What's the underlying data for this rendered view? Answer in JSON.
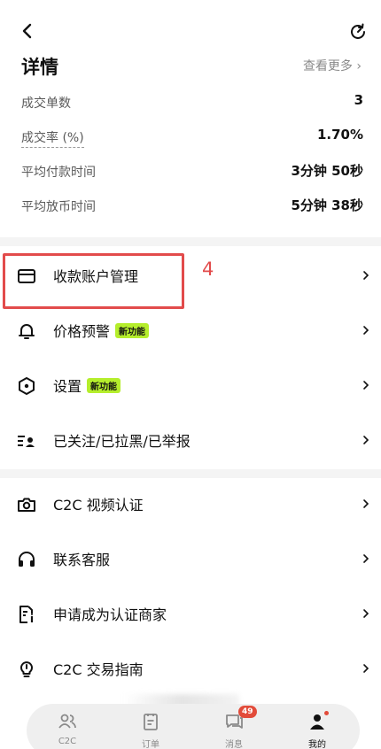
{
  "header": {
    "back_icon": "back-arrow-icon",
    "refresh_icon": "refresh-icon"
  },
  "details": {
    "title": "详情",
    "view_more": "查看更多 ›",
    "stats": [
      {
        "label": "成交单数",
        "value": "3"
      },
      {
        "label": "成交率 (%)",
        "value": "1.70%"
      },
      {
        "label": "平均付款时间",
        "value": "3分钟 50秒"
      },
      {
        "label": "平均放币时间",
        "value": "5分钟 38秒"
      }
    ]
  },
  "menu": {
    "group1": [
      {
        "label": "收款账户管理",
        "icon": "card-icon"
      },
      {
        "label": "价格预警",
        "icon": "bell-icon",
        "badge": "新功能"
      },
      {
        "label": "设置",
        "icon": "settings-hex-icon",
        "badge": "新功能"
      },
      {
        "label": "已关注/已拉黑/已举报",
        "icon": "user-list-icon"
      }
    ],
    "group2": [
      {
        "label": "C2C 视频认证",
        "icon": "camera-icon"
      },
      {
        "label": "联系客服",
        "icon": "headset-icon"
      },
      {
        "label": "申请成为认证商家",
        "icon": "merchant-doc-icon"
      },
      {
        "label": "C2C 交易指南",
        "icon": "lightbulb-icon"
      }
    ]
  },
  "annotation": {
    "number": "4",
    "color": "#e24b4b"
  },
  "bottom_nav": {
    "items": [
      {
        "label": "C2C",
        "icon": "c2c-people-icon"
      },
      {
        "label": "订单",
        "icon": "orders-icon"
      },
      {
        "label": "消息",
        "icon": "messages-icon",
        "badge": "49"
      },
      {
        "label": "我的",
        "icon": "profile-icon",
        "active": true
      }
    ]
  },
  "colors": {
    "accent_badge": "#b5ee2c",
    "alert_red": "#e24b3a"
  }
}
